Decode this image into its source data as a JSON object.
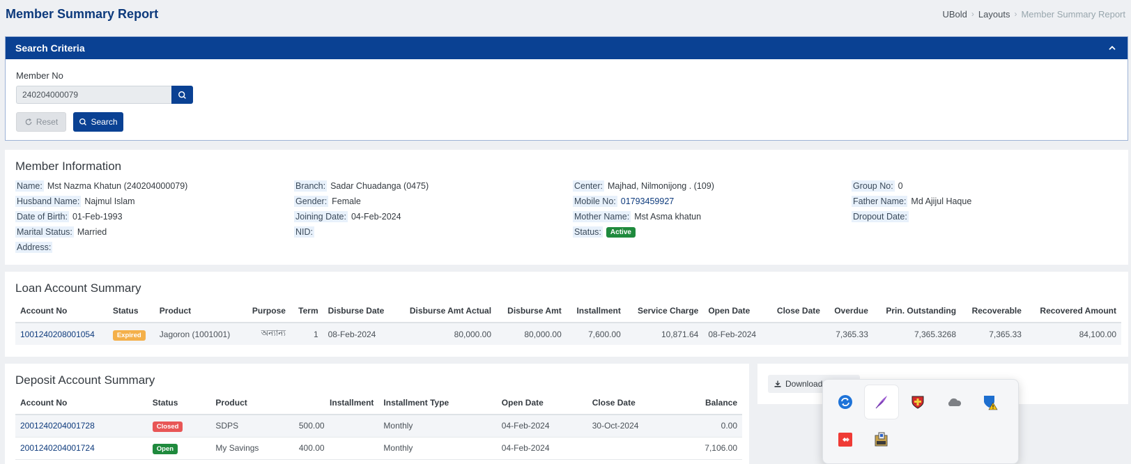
{
  "header": {
    "title": "Member Summary Report",
    "breadcrumb": [
      "UBold",
      "Layouts",
      "Member Summary Report"
    ]
  },
  "search": {
    "title": "Search Criteria",
    "member_label": "Member No",
    "member_value": "240204000079",
    "reset_label": "Reset",
    "search_label": "Search"
  },
  "member": {
    "title": "Member Information",
    "col1": [
      {
        "k": "Name:",
        "v": "Mst Nazma Khatun (240204000079)"
      },
      {
        "k": "Husband Name:",
        "v": "Najmul Islam"
      },
      {
        "k": "Date of Birth:",
        "v": "01-Feb-1993"
      },
      {
        "k": "Marital Status:",
        "v": "Married"
      },
      {
        "k": "Address:",
        "v": ""
      }
    ],
    "col2": [
      {
        "k": "Branch:",
        "v": "Sadar Chuadanga (0475)"
      },
      {
        "k": "Gender:",
        "v": "Female"
      },
      {
        "k": "Joining Date:",
        "v": "04-Feb-2024"
      },
      {
        "k": "NID:",
        "v": ""
      }
    ],
    "col3": [
      {
        "k": "Center:",
        "v": "Majhad, Nilmonijong . (109)"
      },
      {
        "k": "Mobile No:",
        "v": "01793459927"
      },
      {
        "k": "Mother Name:",
        "v": "Mst Asma khatun"
      },
      {
        "k": "Status:",
        "v": "Active"
      }
    ],
    "col4": [
      {
        "k": "Group No:",
        "v": "0"
      },
      {
        "k": "Father Name:",
        "v": "Md Ajijul Haque"
      },
      {
        "k": "Dropout Date:",
        "v": ""
      }
    ]
  },
  "loan": {
    "title": "Loan Account Summary",
    "headers": [
      "Account No",
      "Status",
      "Product",
      "Purpose",
      "Term",
      "Disburse Date",
      "Disburse Amt Actual",
      "Disburse Amt",
      "Installment",
      "Service Charge",
      "Open Date",
      "Close Date",
      "Overdue",
      "Prin. Outstanding",
      "Recoverable",
      "Recovered Amount"
    ],
    "rows": [
      {
        "account": "1001240208001054",
        "status": "Expired",
        "product": "Jagoron (1001001)",
        "purpose": "অন্যান্য",
        "term": "1",
        "disburse_date": "08-Feb-2024",
        "disburse_actual": "80,000.00",
        "disburse_amt": "80,000.00",
        "installment": "7,600.00",
        "service_charge": "10,871.64",
        "open_date": "08-Feb-2024",
        "close_date": "",
        "overdue": "7,365.33",
        "prin_outstanding": "7,365.3268",
        "recoverable": "7,365.33",
        "recovered": "84,100.00"
      }
    ]
  },
  "deposit": {
    "title": "Deposit Account Summary",
    "headers": [
      "Account No",
      "Status",
      "Product",
      "Installment",
      "Installment Type",
      "Open Date",
      "Close Date",
      "Balance"
    ],
    "rows": [
      {
        "account": "2001240204001728",
        "status": "Closed",
        "product": "SDPS",
        "installment": "500.00",
        "type": "Monthly",
        "open_date": "04-Feb-2024",
        "close_date": "30-Oct-2024",
        "balance": "0.00"
      },
      {
        "account": "2001240204001724",
        "status": "Open",
        "product": "My Savings",
        "installment": "400.00",
        "type": "Monthly",
        "open_date": "04-Feb-2024",
        "close_date": "",
        "balance": "7,106.00"
      }
    ]
  },
  "download": {
    "label": "Download"
  },
  "colors": {
    "primary": "#0a4193",
    "title": "#0d3a7c",
    "active": "#1f8a3d",
    "expired": "#f4b04a",
    "closed": "#e85656"
  },
  "tray_icons": [
    "sync-icon",
    "feather-icon",
    "shield-red-icon",
    "cloud-icon",
    "security-warning-icon",
    "anydesk-icon",
    "usb-drive-icon"
  ]
}
